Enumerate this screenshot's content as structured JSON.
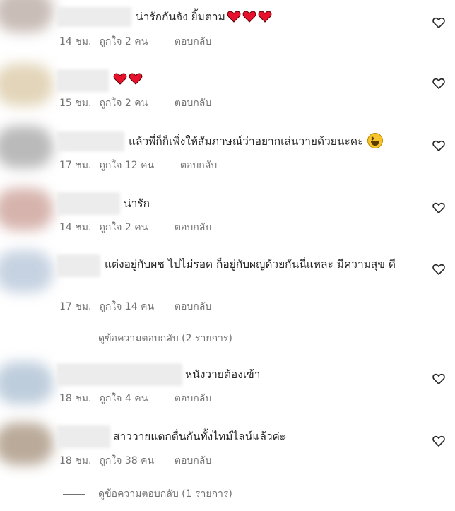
{
  "comments": [
    {
      "text": "น่ารักกันจัง ยิ้มตาม",
      "red_hearts": 3,
      "time": "14 ชม.",
      "likes": "ถูกใจ 2 คน",
      "reply": "ตอบกลับ",
      "avatar_color": "#b8a7a0"
    },
    {
      "text": "",
      "red_hearts": 2,
      "time": "15 ชม.",
      "likes": "ถูกใจ 2 คน",
      "reply": "ตอบกลับ",
      "avatar_color": "#d9c7a2"
    },
    {
      "text": "แล้วพี่ก็ก็เพิ่งให้สัมภาษณ์ว่าอยากเล่นวายด้วยนะคะ",
      "emoji": "grinning-squinting-face",
      "time": "17 ชม.",
      "likes": "ถูกใจ 12 คน",
      "reply": "ตอบกลับ",
      "avatar_color": "#a3a3a3"
    },
    {
      "text": "น่ารัก",
      "time": "14 ชม.",
      "likes": "ถูกใจ 2 คน",
      "reply": "ตอบกลับ",
      "avatar_color": "#c99b92"
    },
    {
      "text": "แต่งอยู่กับผช ไปไม่รอด ก็อยู่กับผญด้วยกันนี่แหละ มีความสุข ดี",
      "time": "17 ชม.",
      "likes": "ถูกใจ 14 คน",
      "reply": "ตอบกลับ",
      "avatar_color": "#b4c4d8"
    },
    {
      "text": "หนังวายต้องเข้า",
      "time": "18 ชม.",
      "likes": "ถูกใจ 4 คน",
      "reply": "ตอบกลับ",
      "avatar_color": "#a9bdd1"
    },
    {
      "text": "สาววายแตกตื่นกันทั้งไทม์ไลน์แล้วค่ะ",
      "time": "18 ชม.",
      "likes": "ถูกใจ 38 คน",
      "reply": "ตอบกลับ",
      "avatar_color": "#a38e78"
    }
  ],
  "view_replies": [
    "ดูข้อความตอบกลับ (2 รายการ)",
    "ดูข้อความตอบกลับ (1 รายการ)"
  ],
  "colors": {
    "text": "#262626",
    "secondary": "#737373",
    "red_heart": "#e8112d"
  },
  "icons": {
    "like": "heart-outline-icon",
    "emoji_heart": "red-heart-emoji"
  }
}
